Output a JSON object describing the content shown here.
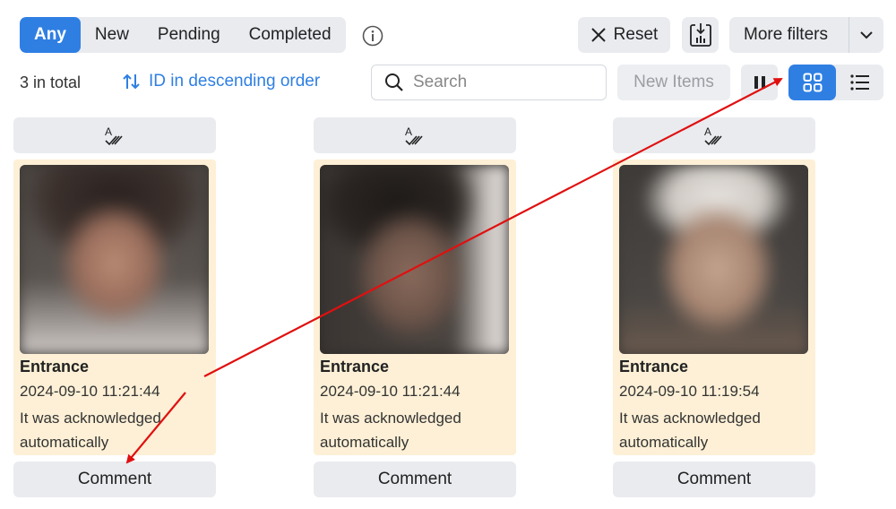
{
  "filters": {
    "tabs": [
      {
        "label": "Any",
        "active": true
      },
      {
        "label": "New",
        "active": false
      },
      {
        "label": "Pending",
        "active": false
      },
      {
        "label": "Completed",
        "active": false
      }
    ]
  },
  "toolbar": {
    "reset_label": "Reset",
    "more_filters_label": "More filters",
    "accent": "#2f7fe3"
  },
  "list_controls": {
    "total_text": "3 in total",
    "sort_text": "ID in descending order",
    "search_placeholder": "Search",
    "new_items_label": "New Items"
  },
  "cards": [
    {
      "location": "Entrance",
      "time": "2024-09-10 11:21:44",
      "status": "It was acknowledged automatically",
      "comment_label": "Comment"
    },
    {
      "location": "Entrance",
      "time": "2024-09-10 11:21:44",
      "status": "It was acknowledged automatically",
      "comment_label": "Comment"
    },
    {
      "location": "Entrance",
      "time": "2024-09-10 11:19:54",
      "status": "It was acknowledged automatically",
      "comment_label": "Comment"
    }
  ],
  "annotation_color": "#e01010"
}
